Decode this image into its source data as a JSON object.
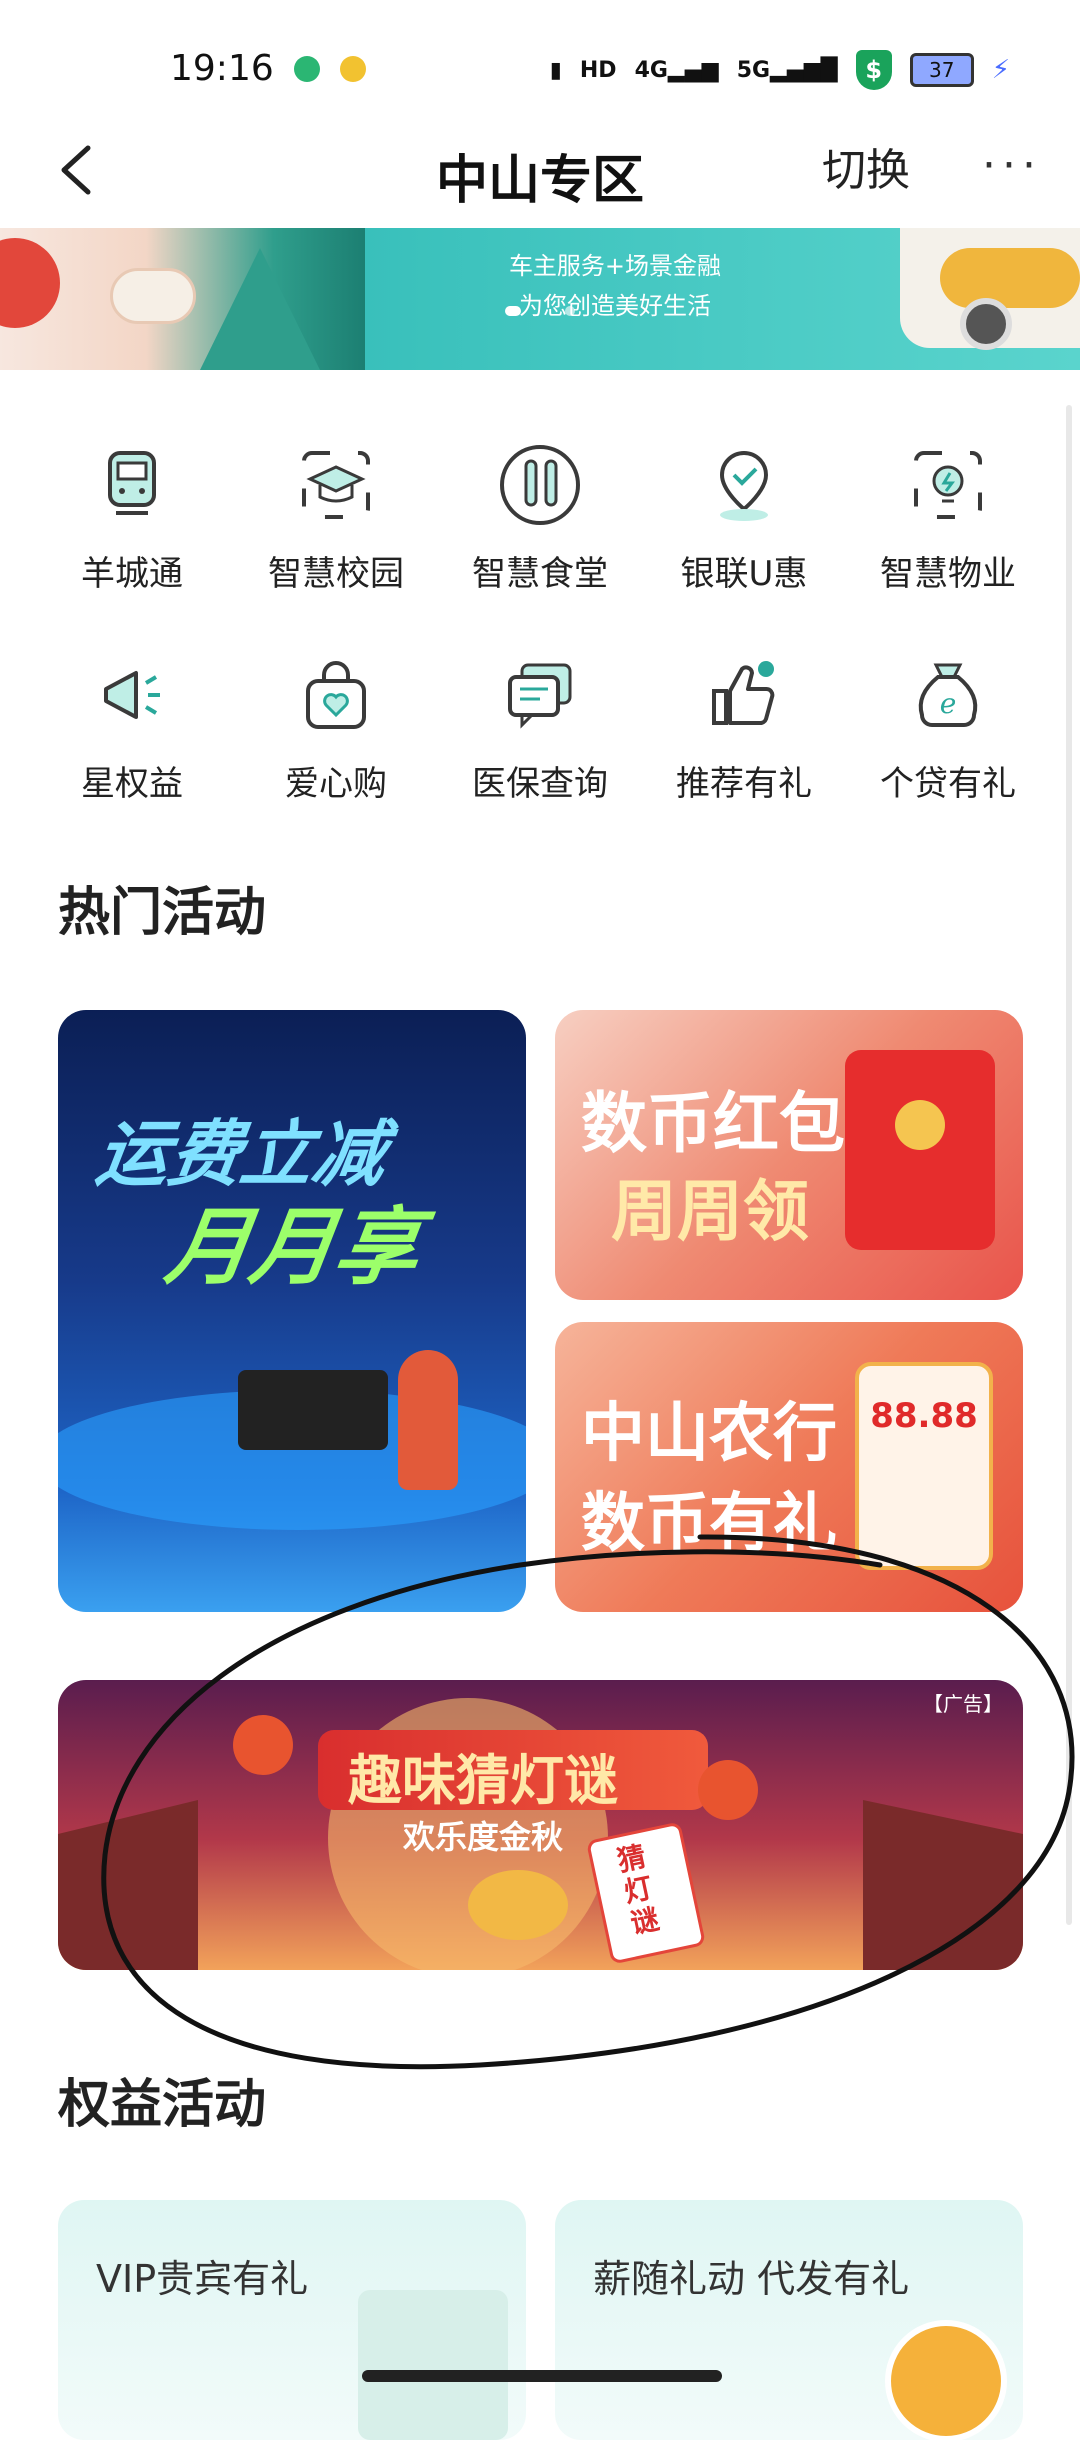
{
  "status_bar": {
    "time": "19:16",
    "battery": "37"
  },
  "nav": {
    "title": "中山专区",
    "switch_label": "切换",
    "more_label": "···"
  },
  "banner": {
    "line1": "车主服务+场景金融",
    "line2": "为您创造美好生活"
  },
  "services": [
    {
      "label": "羊城通",
      "icon": "metro-icon"
    },
    {
      "label": "智慧校园",
      "icon": "graduation-cap-icon"
    },
    {
      "label": "智慧食堂",
      "icon": "fork-knife-icon"
    },
    {
      "label": "银联U惠",
      "icon": "location-check-icon"
    },
    {
      "label": "智慧物业",
      "icon": "lightbulb-icon"
    },
    {
      "label": "星权益",
      "icon": "megaphone-icon"
    },
    {
      "label": "爱心购",
      "icon": "heart-bag-icon"
    },
    {
      "label": "医保查询",
      "icon": "chat-bubble-icon"
    },
    {
      "label": "推荐有礼",
      "icon": "thumbs-up-icon"
    },
    {
      "label": "个贷有礼",
      "icon": "money-bag-icon"
    }
  ],
  "hot": {
    "title": "热门活动",
    "card1": {
      "line1": "运费立减",
      "line2": "月月享"
    },
    "card2": {
      "line1": "数币红包",
      "line2": "周周领"
    },
    "card3": {
      "line1": "中山农行",
      "line2": "数币有礼",
      "amount": "88.88"
    },
    "ad": {
      "tag": "【广告】",
      "title": "趣味猜灯谜",
      "subtitle": "欢乐度金秋",
      "stamp": "猜灯谜"
    }
  },
  "benefits": {
    "title": "权益活动",
    "card1": "VIP贵宾有礼",
    "card2": "薪随礼动 代发有礼"
  },
  "colors": {
    "accent": "#2aa89b",
    "icon_stroke": "#3a9e8e"
  }
}
